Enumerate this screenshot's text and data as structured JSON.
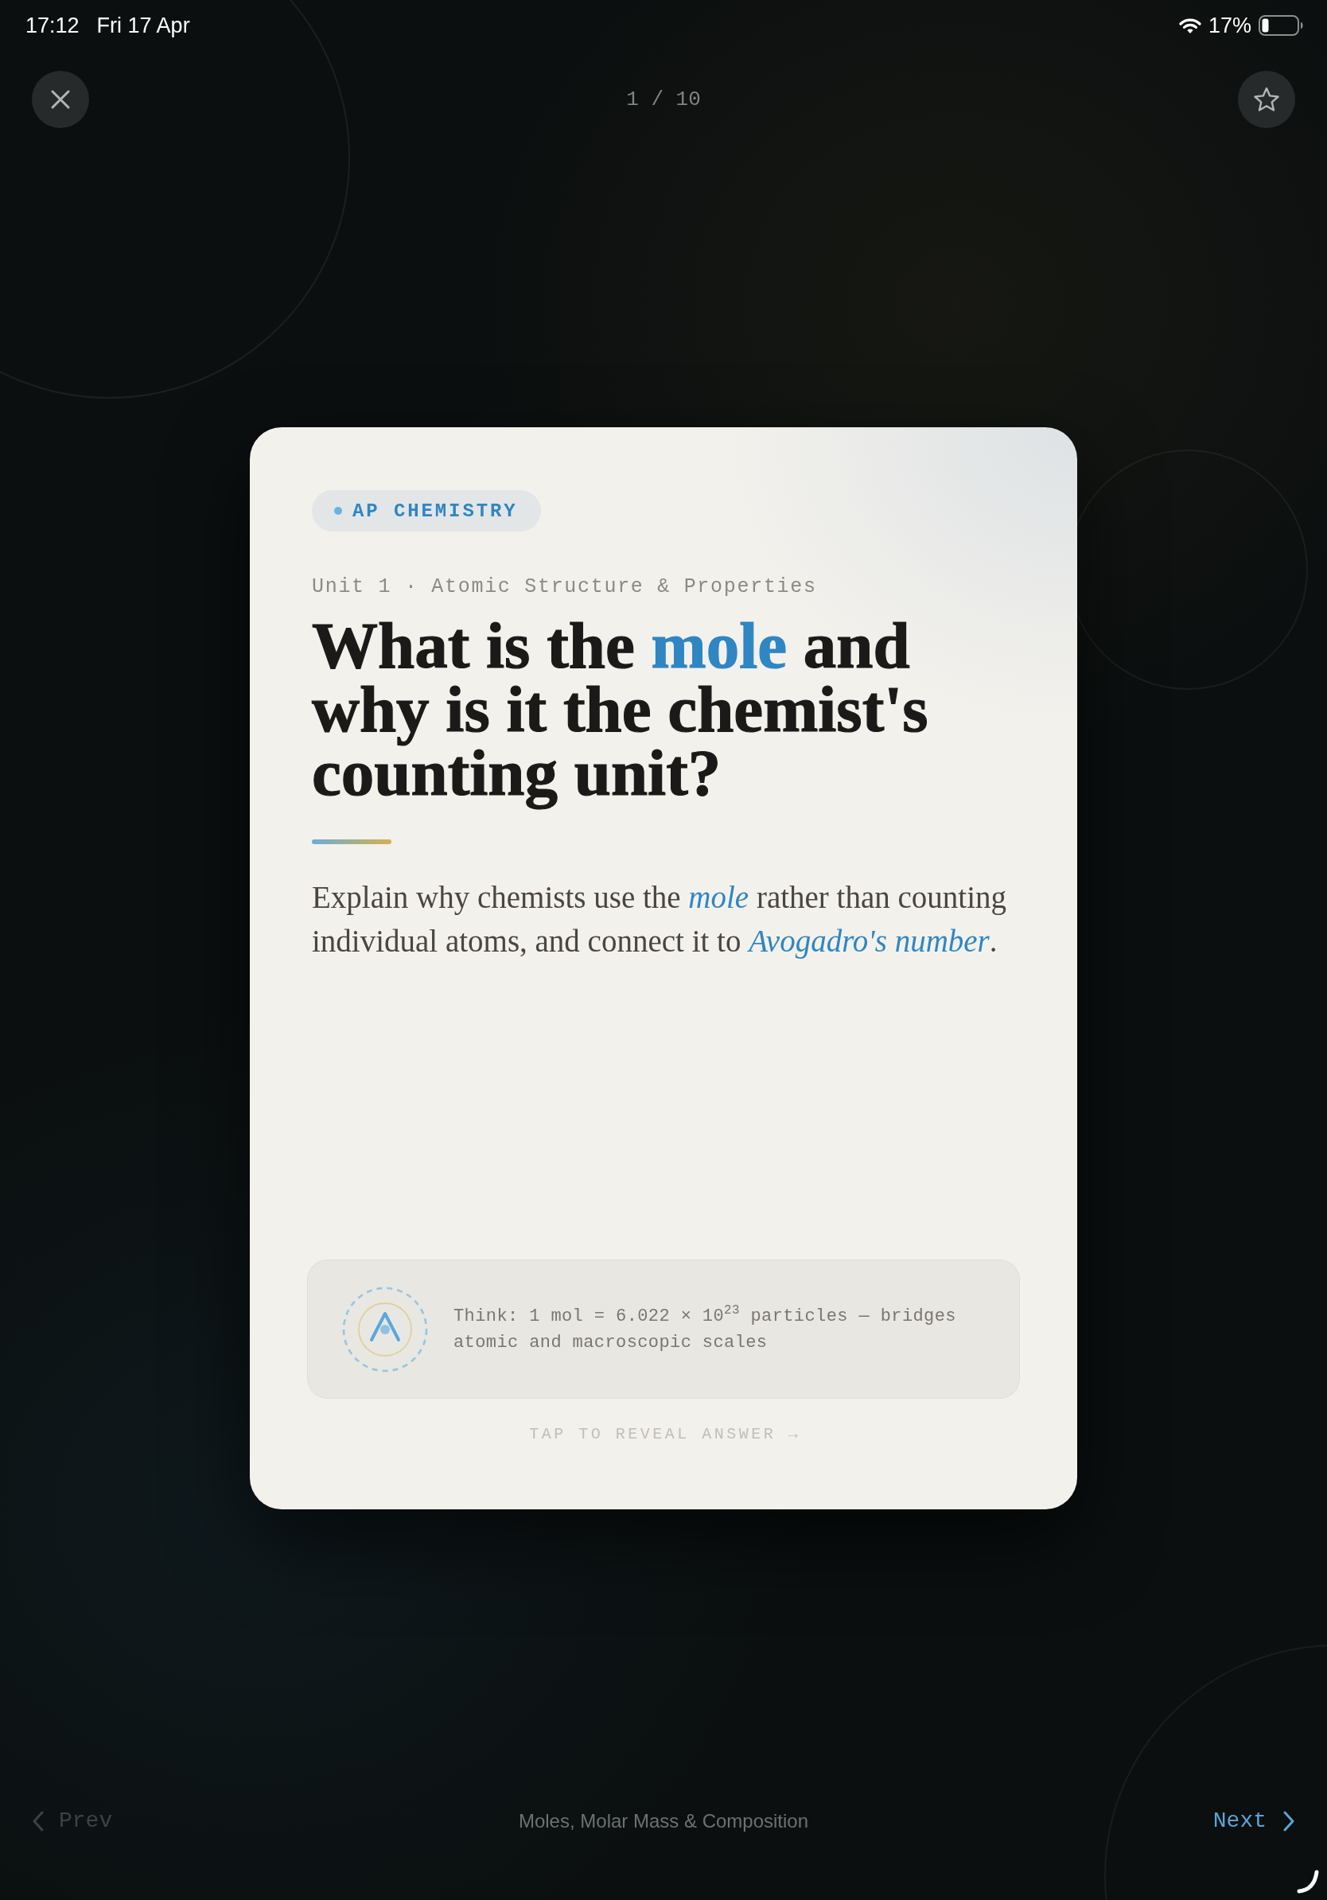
{
  "status_bar": {
    "time": "17:12",
    "date": "Fri 17 Apr",
    "battery": "17%"
  },
  "top_bar": {
    "progress": "1 / 10",
    "starred": false
  },
  "card": {
    "tag": "AP CHEMISTRY",
    "unit": "Unit 1 · Atomic Structure & Properties",
    "title": [
      {
        "text": "What is the ",
        "highlight": false
      },
      {
        "text": "mole",
        "highlight": true
      },
      {
        "text": " and why is it the chemist's counting unit?",
        "highlight": false
      }
    ],
    "prompt": "Explain why chemists use the *mole* rather than counting individual atoms, and connect it to *Avogadro's number*.",
    "hint": "Think: 1 mol = 6.022 × 10$^{23}$ particles — bridges atomic and macroscopic scales",
    "reveal": "TAP TO REVEAL ANSWER →"
  },
  "nav": {
    "prev": {
      "label": "Prev",
      "disabled": true
    },
    "deck": "Moles, Molar Mass & Composition",
    "next": {
      "label": "Next",
      "disabled": false
    }
  }
}
